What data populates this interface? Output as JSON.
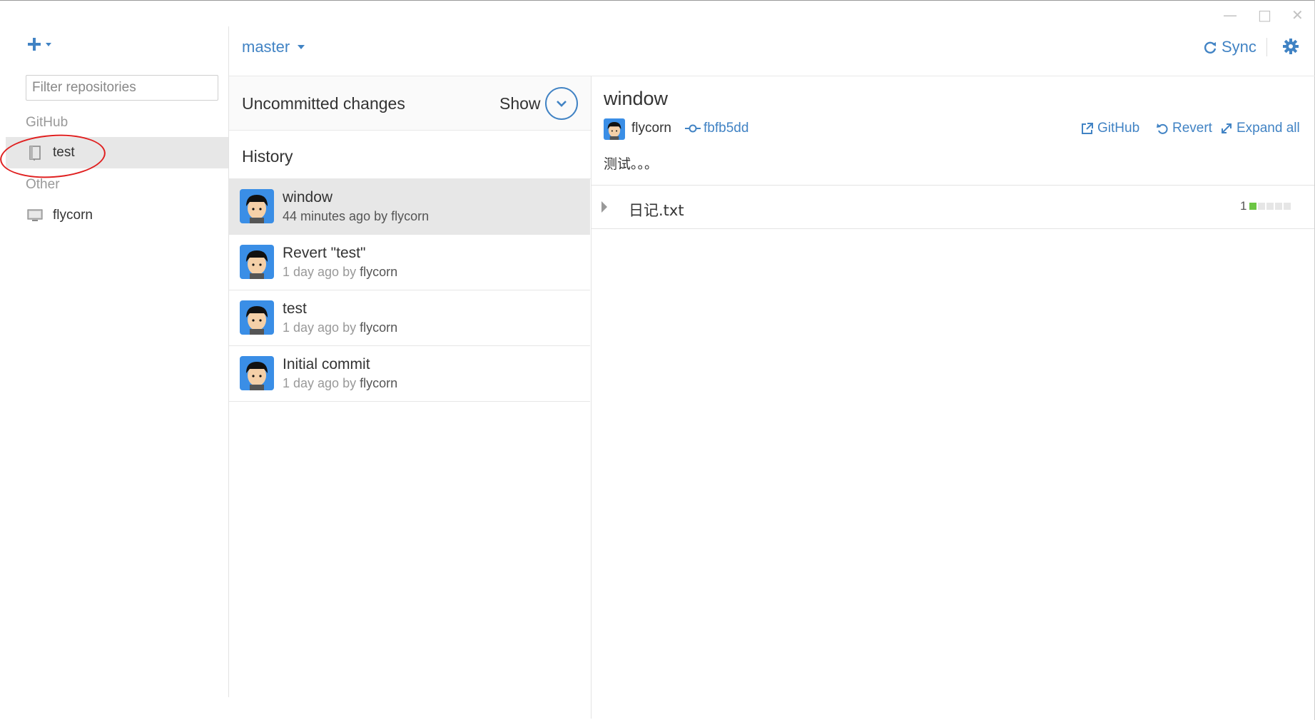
{
  "window": {
    "minimize": "—",
    "maximize": "□",
    "close": "✕"
  },
  "sidebar": {
    "filter_placeholder": "Filter repositories",
    "groups": [
      {
        "label": "GitHub",
        "repos": [
          {
            "name": "test",
            "icon": "book-icon",
            "selected": true
          }
        ]
      },
      {
        "label": "Other",
        "repos": [
          {
            "name": "flycorn",
            "icon": "computer-icon",
            "selected": false
          }
        ]
      }
    ]
  },
  "toolbar": {
    "branch": "master",
    "sync_label": "Sync"
  },
  "changes": {
    "uncommitted_label": "Uncommitted changes",
    "show_label": "Show"
  },
  "history": {
    "title": "History",
    "commits": [
      {
        "title": "window",
        "time": "44 minutes ago by",
        "author": "flycorn",
        "selected": true
      },
      {
        "title": "Revert \"test\"",
        "time": "1 day ago by",
        "author": "flycorn",
        "selected": false
      },
      {
        "title": "test",
        "time": "1 day ago by",
        "author": "flycorn",
        "selected": false
      },
      {
        "title": "Initial commit",
        "time": "1 day ago by",
        "author": "flycorn",
        "selected": false
      }
    ]
  },
  "detail": {
    "title": "window",
    "author": "flycorn",
    "sha": "fbfb5dd",
    "github_label": "GitHub",
    "revert_label": "Revert",
    "expand_label": "Expand all",
    "message": "测试。。。",
    "files": [
      {
        "name": "日记.txt",
        "changes": "1",
        "additions_blocks": 1,
        "total_blocks": 5
      }
    ]
  },
  "colors": {
    "accent": "#4183c4",
    "selection": "#e7e7e7",
    "addition": "#6cc644",
    "annotation": "#e02020"
  }
}
